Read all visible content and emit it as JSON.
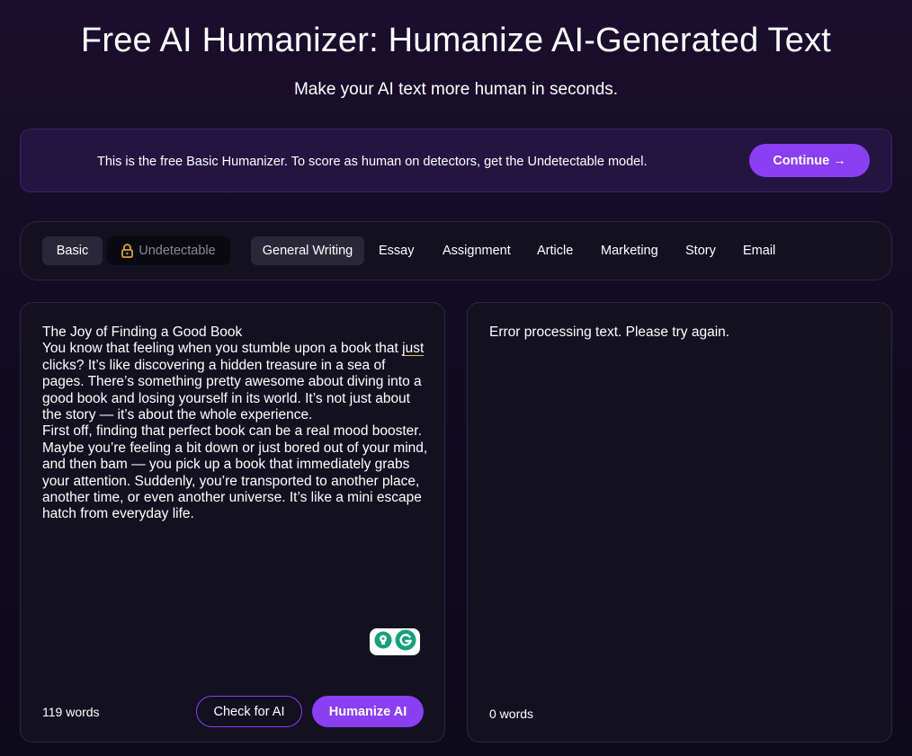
{
  "header": {
    "title": "Free AI Humanizer: Humanize AI-Generated Text",
    "subtitle": "Make your AI text more human in seconds."
  },
  "banner": {
    "text": "This is the free Basic Humanizer. To score as human on detectors, get the Undetectable model.",
    "cta_label": "Continue →"
  },
  "modes": {
    "basic_label": "Basic",
    "undetectable_label": "Undetectable",
    "selected": "Basic"
  },
  "purposes": {
    "selected": "General Writing",
    "items": [
      "General Writing",
      "Essay",
      "Assignment",
      "Article",
      "Marketing",
      "Story",
      "Email"
    ]
  },
  "input": {
    "title_line": "The Joy of Finding a Good Book",
    "para1_before": "You know that feeling when you stumble upon a book that ",
    "para1_underlined": "just",
    "para1_after": " clicks? It’s like discovering a hidden treasure in a sea of pages. There’s something pretty awesome about diving into a good book and losing yourself in its world. It’s not just about the story — it’s about the whole experience.",
    "para2": "First off, finding that perfect book can be a real mood booster. Maybe you’re feeling a bit down or just bored out of your mind, and then bam — you pick up a book that immediately grabs your attention. Suddenly, you’re transported to another place, another time, or even another universe. It’s like a mini escape hatch from everyday life.",
    "word_count": "119 words",
    "check_label": "Check for AI",
    "humanize_label": "Humanize AI"
  },
  "output": {
    "message": "Error processing text. Please try again.",
    "word_count": "0 words"
  },
  "colors": {
    "accent": "#8b3ff2",
    "banner_bg": "#231541",
    "panel_bg": "#131020",
    "grammarly_green": "#15a17a"
  },
  "icons": {
    "lock": "lock-icon",
    "grammarly": "grammarly-icon",
    "suggestion": "lightbulb-icon"
  }
}
